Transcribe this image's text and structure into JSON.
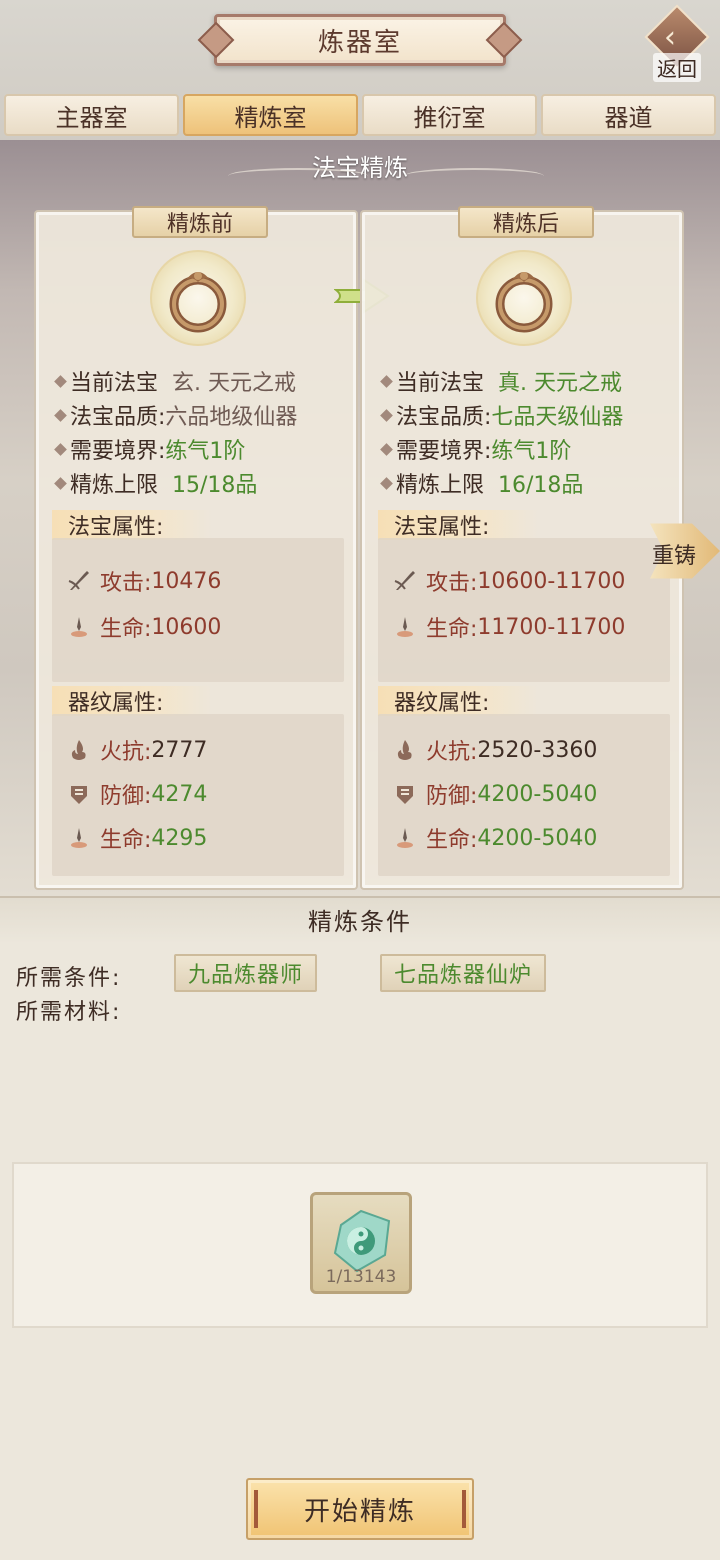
{
  "header": {
    "title": "炼器室",
    "back_label": "返回"
  },
  "tabs": [
    {
      "label": "主器室",
      "active": false
    },
    {
      "label": "精炼室",
      "active": true
    },
    {
      "label": "推衍室",
      "active": false
    },
    {
      "label": "器道",
      "active": false
    }
  ],
  "section_title": "法宝精炼",
  "before": {
    "head": "精炼前",
    "current_label": "当前法宝",
    "current_value": "玄. 天元之戒",
    "quality_label": "法宝品质:",
    "quality_value": "六品地级仙器",
    "realm_label": "需要境界:",
    "realm_value": "练气1阶",
    "limit_label": "精炼上限",
    "limit_value": "15/18品",
    "attr_head": "法宝属性:",
    "attack_label": "攻击:",
    "attack_value": "10476",
    "life_label": "生命:",
    "life_value": "10600",
    "pattern_head": "器纹属性:",
    "fire_label": "火抗:",
    "fire_value": "2777",
    "defense_label": "防御:",
    "defense_value": "4274",
    "life2_label": "生命:",
    "life2_value": "4295"
  },
  "after": {
    "head": "精炼后",
    "current_label": "当前法宝",
    "current_value": "真. 天元之戒",
    "quality_label": "法宝品质:",
    "quality_value": "七品天级仙器",
    "realm_label": "需要境界:",
    "realm_value": "练气1阶",
    "limit_label": "精炼上限",
    "limit_value": "16/18品",
    "attr_head": "法宝属性:",
    "attack_label": "攻击:",
    "attack_value": "10600-11700",
    "life_label": "生命:",
    "life_value": "11700-11700",
    "pattern_head": "器纹属性:",
    "fire_label": "火抗:",
    "fire_value": "2520-3360",
    "defense_label": "防御:",
    "defense_value": "4200-5040",
    "life2_label": "生命:",
    "life2_value": "4200-5040"
  },
  "recast_label": "重铸",
  "conditions": {
    "head": "精炼条件",
    "req_label": "所需条件:",
    "mat_label": "所需材料:",
    "chip1": "九品炼器师",
    "chip2": "七品炼器仙炉",
    "material_count": "1/13143"
  },
  "start_button": "开始精炼",
  "colors": {
    "green": "#4c8a2e",
    "red": "#8e3b2d",
    "gold": "#eec27a"
  }
}
